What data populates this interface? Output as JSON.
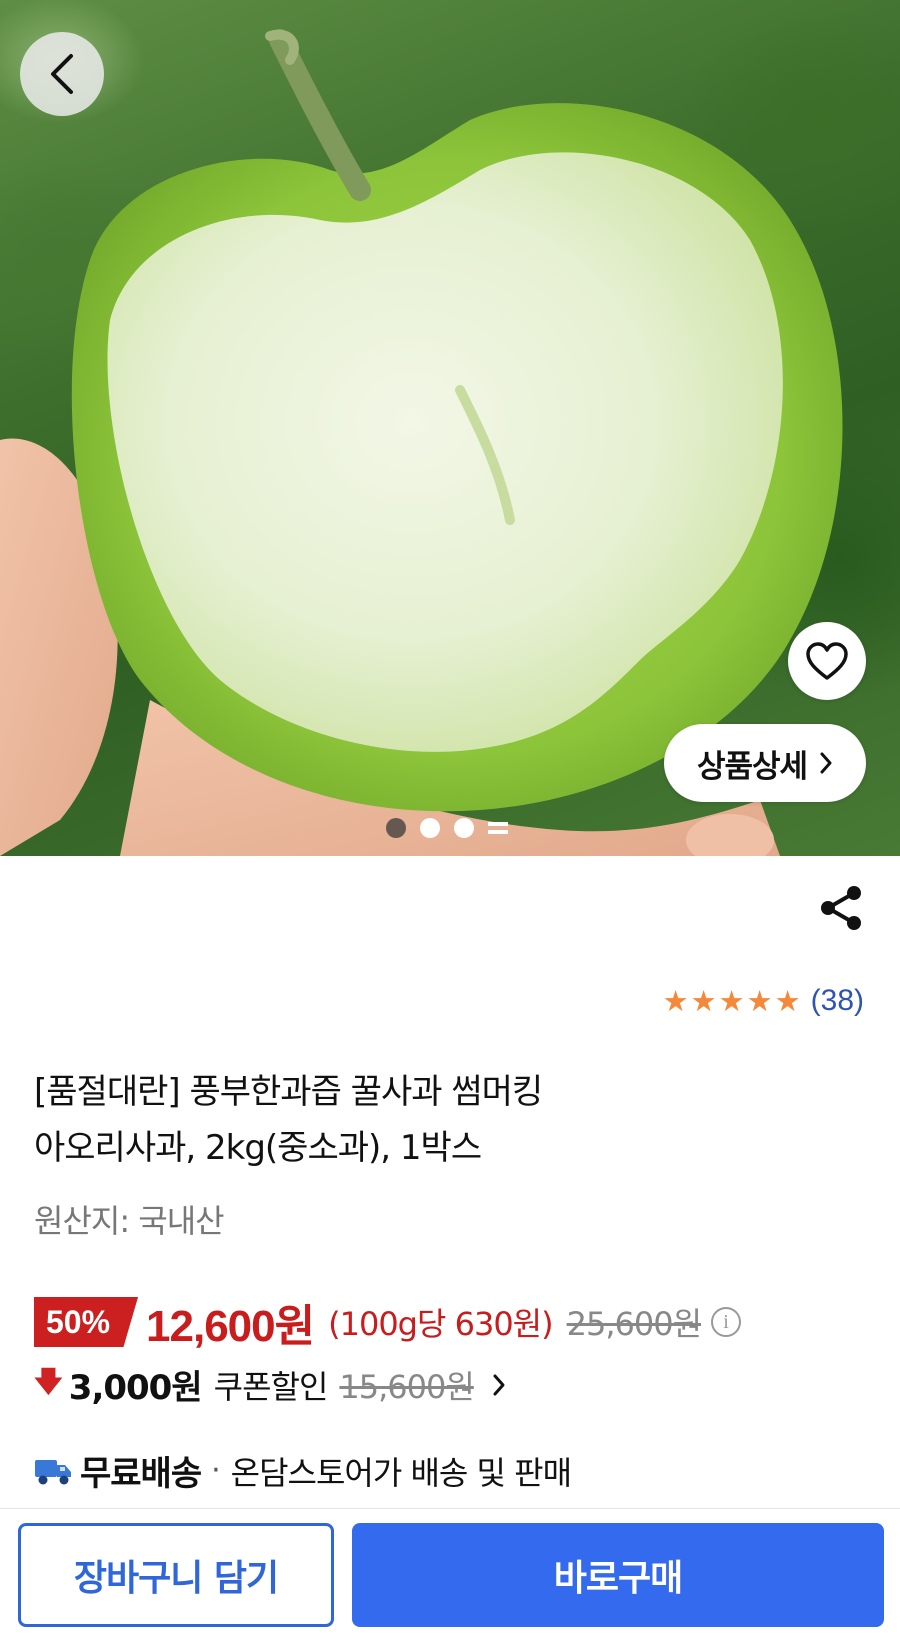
{
  "hero": {
    "image_subject": "green-apple-bitten",
    "gallery_total_dots": 3,
    "gallery_active_index": 0,
    "detail_button_label": "상품상세"
  },
  "icons": {
    "back": "chevron-left-icon",
    "favorite": "heart-outline-icon",
    "detail": "chevron-right-icon",
    "share": "share-icon",
    "info": "info-icon",
    "coupon": "arrow-down-icon",
    "shipping": "truck-icon"
  },
  "product": {
    "rating": 5,
    "review_count": "(38)",
    "title_line1": "[품절대란] 풍부한과즙 꿀사과 썸머킹",
    "title_line2": "아오리사과, 2kg(중소과), 1박스",
    "origin": "원산지: 국내산"
  },
  "price": {
    "discount_rate": "50%",
    "sale_price": "12,600원",
    "unit_price": "(100g당 630원)",
    "original_price": "25,600원",
    "info_glyph": "i"
  },
  "coupon": {
    "amount": "3,000원",
    "label": "쿠폰할인",
    "original": "15,600원"
  },
  "shipping": {
    "label": "무료배송",
    "separator": "·",
    "description": "온담스토어가 배송 및 판매"
  },
  "actions": {
    "cart_label": "장바구니 담기",
    "buy_label": "바로구매"
  },
  "colors": {
    "brand_blue": "#346aed",
    "sale_red": "#c91d1d",
    "star_orange": "#f5893a",
    "review_blue": "#2f55b3"
  }
}
